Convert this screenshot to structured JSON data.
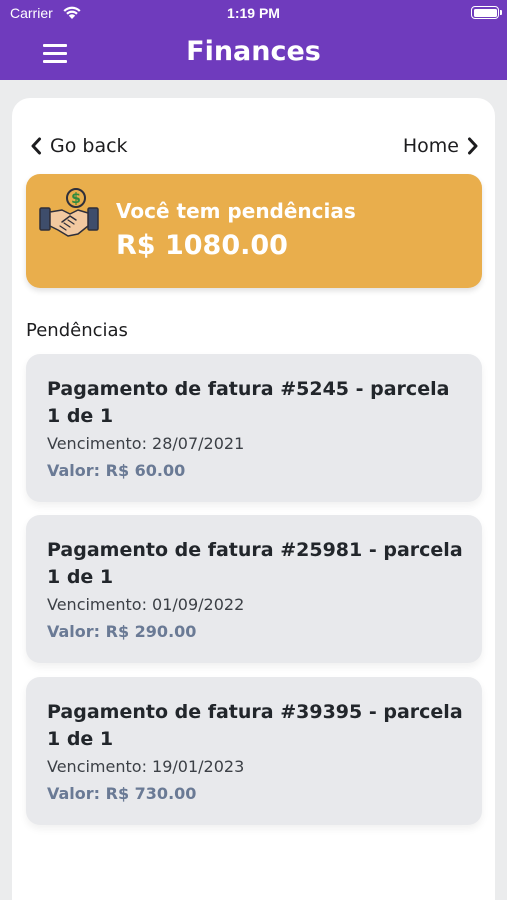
{
  "status_bar": {
    "carrier": "Carrier",
    "time": "1:19 PM",
    "wifi_icon": "wifi-icon",
    "battery_icon": "battery-icon"
  },
  "navbar": {
    "title": "Finances",
    "menu_icon": "hamburger-menu-icon",
    "color": "#6f3bbd"
  },
  "navigation": {
    "back_label": "Go back",
    "back_icon": "chevron-left-icon",
    "home_label": "Home",
    "home_icon": "chevron-right-icon"
  },
  "banner": {
    "icon": "handshake-money-icon",
    "title": "Você tem pendências",
    "amount": "R$ 1080.00",
    "color": "#e9ae4c"
  },
  "pending": {
    "section_title": "Pendências",
    "items": [
      {
        "title": "Pagamento de fatura #5245 - parcela 1 de 1",
        "due": "Vencimento: 28/07/2021",
        "value": "Valor: R$ 60.00"
      },
      {
        "title": "Pagamento de fatura #25981 - parcela 1 de 1",
        "due": "Vencimento: 01/09/2022",
        "value": "Valor: R$ 290.00"
      },
      {
        "title": "Pagamento de fatura #39395 - parcela 1 de 1",
        "due": "Vencimento: 19/01/2023",
        "value": "Valor: R$ 730.00"
      }
    ]
  }
}
